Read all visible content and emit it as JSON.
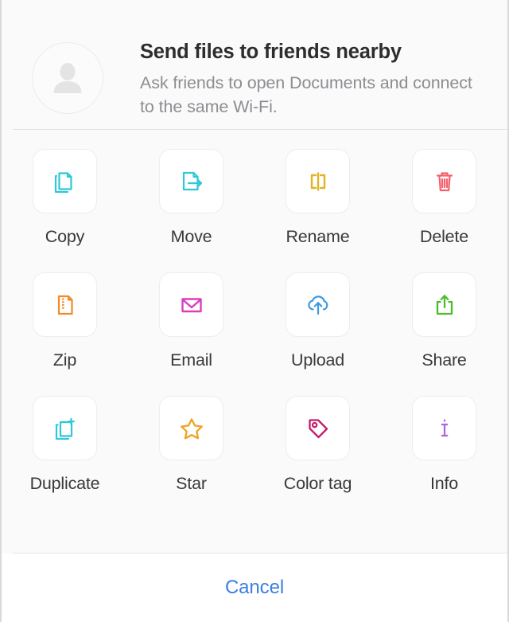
{
  "header": {
    "avatar_icon": "person-avatar-icon",
    "title": "Send files to friends nearby",
    "subtitle": "Ask friends to open Documents and connect to the same Wi-Fi."
  },
  "colors": {
    "sheet_background": "#fafafa",
    "tile_background": "#ffffff",
    "tile_border": "#eeeeee",
    "title_text": "#2d2d2f",
    "subtitle_text": "#8d8d92",
    "label_text": "#39393b",
    "divider": "#e3e3e3",
    "cancel_text": "#3c7ee0",
    "avatar_silhouette": "#e2e2e2"
  },
  "actions": [
    [
      {
        "id": "copy",
        "label": "Copy",
        "icon": "copy-icon",
        "color": "#2ec8d6"
      },
      {
        "id": "move",
        "label": "Move",
        "icon": "move-icon",
        "color": "#2ec8d6"
      },
      {
        "id": "rename",
        "label": "Rename",
        "icon": "rename-icon",
        "color": "#e3b324"
      },
      {
        "id": "delete",
        "label": "Delete",
        "icon": "trash-icon",
        "color": "#f4606c"
      }
    ],
    [
      {
        "id": "zip",
        "label": "Zip",
        "icon": "zip-icon",
        "color": "#f08a2a"
      },
      {
        "id": "email",
        "label": "Email",
        "icon": "envelope-icon",
        "color": "#d93ec0"
      },
      {
        "id": "upload",
        "label": "Upload",
        "icon": "cloud-upload-icon",
        "color": "#3d9ae0"
      },
      {
        "id": "share",
        "label": "Share",
        "icon": "share-icon",
        "color": "#4cbb2c"
      }
    ],
    [
      {
        "id": "duplicate",
        "label": "Duplicate",
        "icon": "duplicate-icon",
        "color": "#2ec8d6"
      },
      {
        "id": "star",
        "label": "Star",
        "icon": "star-icon",
        "color": "#f0a323"
      },
      {
        "id": "color-tag",
        "label": "Color tag",
        "icon": "tag-icon",
        "color": "#c61d6a"
      },
      {
        "id": "info",
        "label": "Info",
        "icon": "info-icon",
        "color": "#a964e0"
      }
    ]
  ],
  "footer": {
    "cancel_label": "Cancel"
  }
}
